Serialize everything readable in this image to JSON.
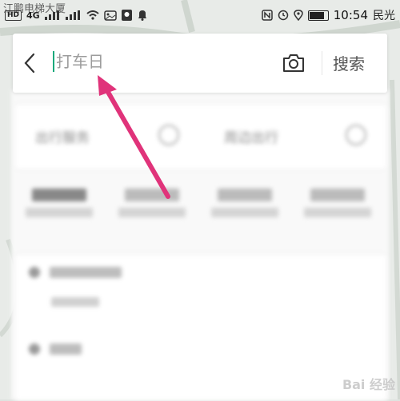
{
  "status_bar": {
    "top_left_text": "江鹏电梯大厦",
    "network_badge": "HD",
    "signal_label": "4G",
    "time": "10:54",
    "top_right_text": "民光"
  },
  "search": {
    "placeholder": "打车日",
    "button_label": "搜索"
  },
  "background": {
    "row1_left": "出行服务",
    "row1_right": "周边出行"
  },
  "watermark": "Bai 经验",
  "annotation_color": "#e0337a",
  "accent_color": "#19a97b"
}
